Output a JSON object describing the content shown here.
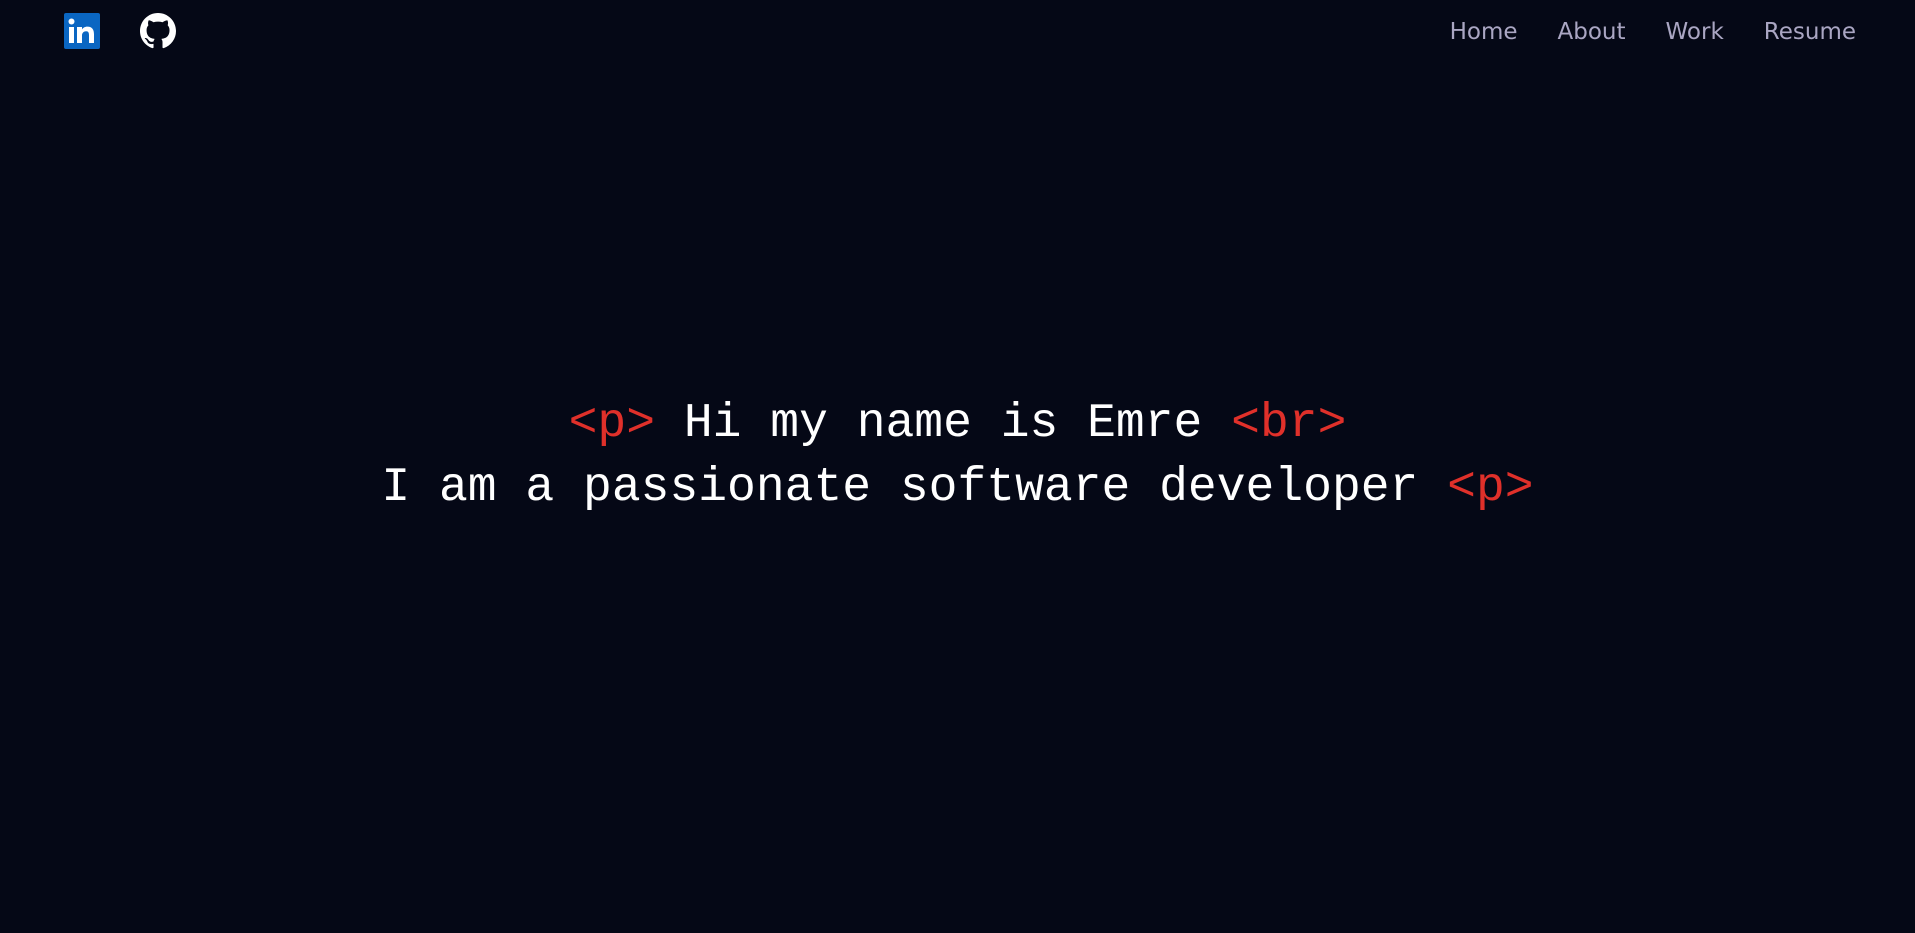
{
  "colors": {
    "background": "#050816",
    "nav_text": "#aaa6c3",
    "hero_text": "#ffffff",
    "tag_accent": "#e0302a",
    "linkedin_brand": "#0a66c2"
  },
  "header": {
    "social": [
      {
        "icon": "linkedin-icon"
      },
      {
        "icon": "github-icon"
      }
    ],
    "nav": [
      "Home",
      "About",
      "Work",
      "Resume"
    ]
  },
  "hero": {
    "line1": {
      "open_tag": "<p>",
      "text": "Hi my name is Emre",
      "break_tag": "<br>"
    },
    "line2": {
      "text": "I am a passionate software developer",
      "close_tag": "<p>"
    }
  }
}
